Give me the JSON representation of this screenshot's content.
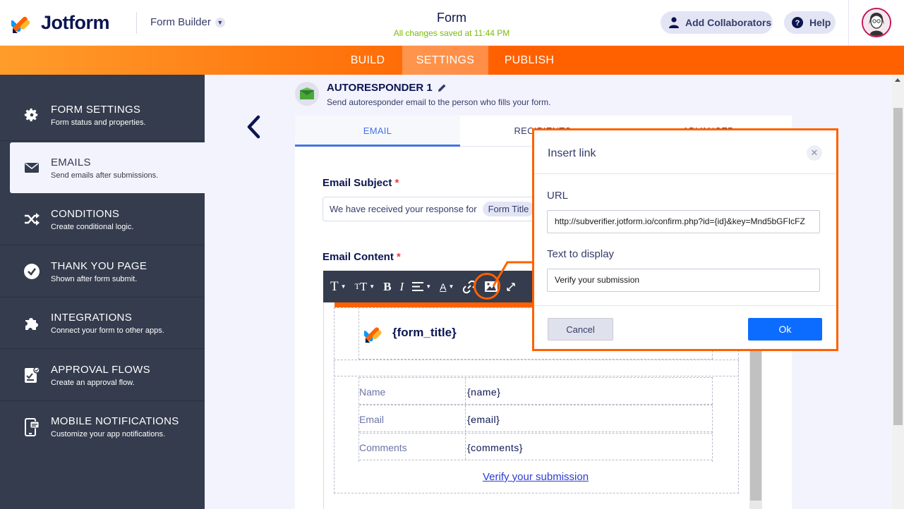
{
  "header": {
    "logo_text": "Jotform",
    "form_builder": "Form Builder",
    "form_title": "Form",
    "saved_status": "All changes saved at 11:44 PM",
    "add_collaborators": "Add Collaborators",
    "help": "Help"
  },
  "nav": {
    "tabs": [
      {
        "label": "BUILD"
      },
      {
        "label": "SETTINGS"
      },
      {
        "label": "PUBLISH"
      }
    ],
    "active": "SETTINGS"
  },
  "sidebar": {
    "items": [
      {
        "title": "FORM SETTINGS",
        "desc": "Form status and properties.",
        "icon": "gear-icon"
      },
      {
        "title": "EMAILS",
        "desc": "Send emails after submissions.",
        "icon": "envelope-icon"
      },
      {
        "title": "CONDITIONS",
        "desc": "Create conditional logic.",
        "icon": "shuffle-icon"
      },
      {
        "title": "THANK YOU PAGE",
        "desc": "Shown after form submit.",
        "icon": "check-circle-icon"
      },
      {
        "title": "INTEGRATIONS",
        "desc": "Connect your form to other apps.",
        "icon": "puzzle-icon"
      },
      {
        "title": "APPROVAL FLOWS",
        "desc": "Create an approval flow.",
        "icon": "approval-icon"
      },
      {
        "title": "MOBILE NOTIFICATIONS",
        "desc": "Customize your app notifications.",
        "icon": "mobile-icon"
      }
    ],
    "active": "EMAILS"
  },
  "autoresponder": {
    "title": "AUTORESPONDER 1",
    "subtitle": "Send autoresponder email to the person who fills your form."
  },
  "panel_tabs": [
    {
      "label": "EMAIL"
    },
    {
      "label": "RECIPIENTS"
    },
    {
      "label": "ADVANCED"
    }
  ],
  "email": {
    "subject_label": "Email Subject",
    "subject_text": "We have received your response for",
    "subject_chip": "Form Title",
    "content_label": "Email Content",
    "required_mark": "*",
    "form_title_var": "{form_title}",
    "rows": [
      {
        "key": "Name",
        "value": "{name}"
      },
      {
        "key": "Email",
        "value": "{email}"
      },
      {
        "key": "Comments",
        "value": "{comments}"
      }
    ],
    "link_text": "Verify your submission"
  },
  "modal": {
    "title": "Insert link",
    "url_label": "URL",
    "url_value": "http://subverifier.jotform.io/confirm.php?id={id}&key=Mnd5bGFIcFZ",
    "text_label": "Text to display",
    "text_value": "Verify your submission",
    "cancel": "Cancel",
    "ok": "Ok"
  },
  "colors": {
    "accent": "#ff6100",
    "sidebar": "#343c4d",
    "primary_button": "#0b6cff",
    "saved": "#78bb07"
  }
}
